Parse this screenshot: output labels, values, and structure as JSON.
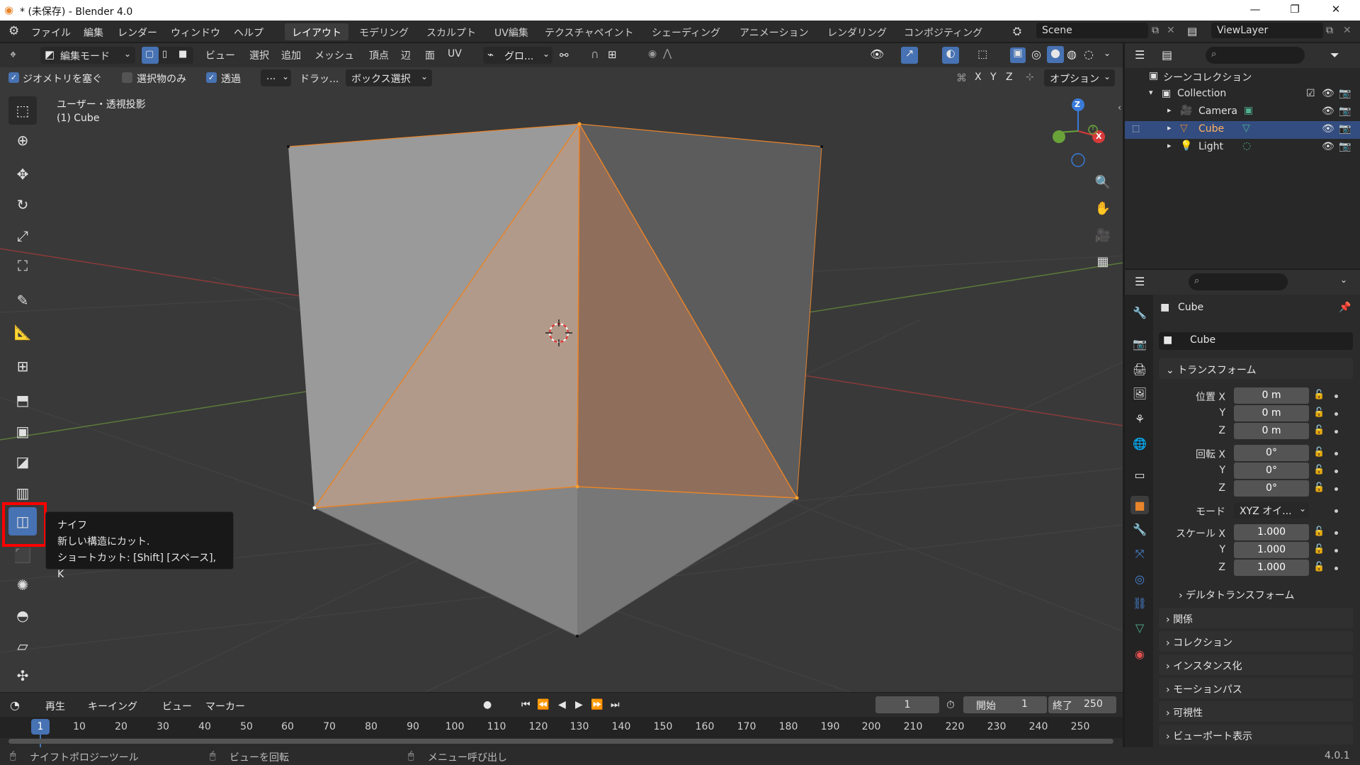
{
  "window": {
    "title": "* (未保存) - Blender 4.0",
    "minimize": "—",
    "maximize": "❐",
    "close": "✕"
  },
  "menu": [
    "ファイル",
    "編集",
    "レンダー",
    "ウィンドウ",
    "ヘルプ"
  ],
  "workspaces": [
    "レイアウト",
    "モデリング",
    "スカルプト",
    "UV編集",
    "テクスチャペイント",
    "シェーディング",
    "アニメーション",
    "レンダリング",
    "コンポジティング"
  ],
  "active_workspace": "レイアウト",
  "scene": {
    "name": "Scene",
    "view_layer": "ViewLayer"
  },
  "viewport_header": {
    "mode": "編集モード",
    "menus": [
      "ビュー",
      "選択",
      "追加",
      "メッシュ",
      "頂点",
      "辺",
      "面",
      "UV"
    ],
    "transform_orientation": "グロ...",
    "axes": [
      "X",
      "Y",
      "Z"
    ],
    "options": "オプション"
  },
  "tool_settings": {
    "geometry_check": "ジオメトリを塞ぐ",
    "selected_only": "選択物のみ",
    "xray": "透過",
    "dots": "...",
    "drag_label": "ドラッ...",
    "box_select": "ボックス選択"
  },
  "viewport_info": {
    "view_name": "ユーザー・透視投影",
    "object_name": "(1) Cube"
  },
  "gizmo": {
    "x": "X",
    "y": "Y",
    "z": "Z"
  },
  "tooltip": {
    "title": "ナイフ",
    "description": "新しい構造にカット.",
    "shortcut": "ショートカット: [Shift] [スペース], K"
  },
  "timeline": {
    "menus": [
      "再生",
      "キーイング",
      "ビュー",
      "マーカー"
    ],
    "current_frame": "1",
    "start_label": "開始",
    "start_value": "1",
    "end_label": "終了",
    "end_value": "250",
    "ticks": [
      "10",
      "20",
      "30",
      "40",
      "50",
      "60",
      "70",
      "80",
      "90",
      "100",
      "110",
      "120",
      "130",
      "140",
      "150",
      "160",
      "170",
      "180",
      "190",
      "200",
      "210",
      "220",
      "230",
      "240",
      "250"
    ],
    "playhead": "1"
  },
  "statusbar": {
    "left": "ナイフトポロジーツール",
    "middle": "ビューを回転",
    "right": "メニュー呼び出し",
    "version": "4.0.1"
  },
  "outliner": {
    "root": "シーンコレクション",
    "collection": "Collection",
    "items": [
      "Camera",
      "Cube",
      "Light"
    ]
  },
  "properties": {
    "object_name": "Cube",
    "data_name": "Cube",
    "transform_title": "トランスフォーム",
    "location_label": "位置 X",
    "rotation_label": "回転 X",
    "scale_label": "スケール X",
    "y_label": "Y",
    "z_label": "Z",
    "location": [
      "0 m",
      "0 m",
      "0 m"
    ],
    "rotation": [
      "0°",
      "0°",
      "0°"
    ],
    "mode_label": "モード",
    "mode_value": "XYZ オイ...",
    "scale": [
      "1.000",
      "1.000",
      "1.000"
    ],
    "sections": [
      "デルタトランスフォーム",
      "関係",
      "コレクション",
      "インスタンス化",
      "モーションパス",
      "可視性",
      "ビューポート表示"
    ]
  },
  "colors": {
    "accent": "#4772b3",
    "selection_orange": "#e8842a",
    "highlight_red": "#ff0000"
  }
}
